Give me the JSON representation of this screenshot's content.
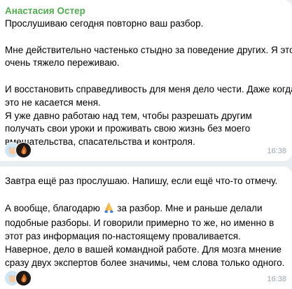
{
  "message1": {
    "sender": "Анастасия Остер",
    "lines": [
      "Прослушиваю сегодня повторно ваш разбор.",
      "",
      "Мне действительно частенько стыдно за поведение других. Я это",
      "очень тяжело переживаю.",
      "",
      "И восстановить справедливость для меня дело чести. Даже когда",
      "это не касается меня.",
      "Я уже давно работаю над тем, чтобы разрешать другим",
      "получать свои уроки и проживать свою жизнь без моего",
      "вмешательства, спасательства и контроля."
    ],
    "time": "16:38",
    "reactions": [
      "avatar-reaction",
      "dark-avatar-reaction"
    ]
  },
  "message2": {
    "line1": "Завтра ещё раз прослушаю. Напишу, если ещё что-то отмечу.",
    "line3_before": "А вообще, благодарю ",
    "line3_after": " за разбор. Мне и раньше делали",
    "lines_rest": [
      "подобные разборы. И говорили примерно то же, но именно в",
      "этот раз информация по-настоящему проваливается.",
      "Наверное, дело в вашей командной работе. Для мозга мнение",
      "сразу двух экспертов более значимы, чем слова только одного."
    ],
    "inline_emoji": "folded-hands-icon",
    "time": "16:38",
    "reactions": [
      "avatar-reaction",
      "dark-avatar-reaction"
    ]
  },
  "colors": {
    "background": "#e9eef2",
    "bubble": "#ffffff",
    "sender": "#4fae4e",
    "time": "#9aa3ab"
  }
}
